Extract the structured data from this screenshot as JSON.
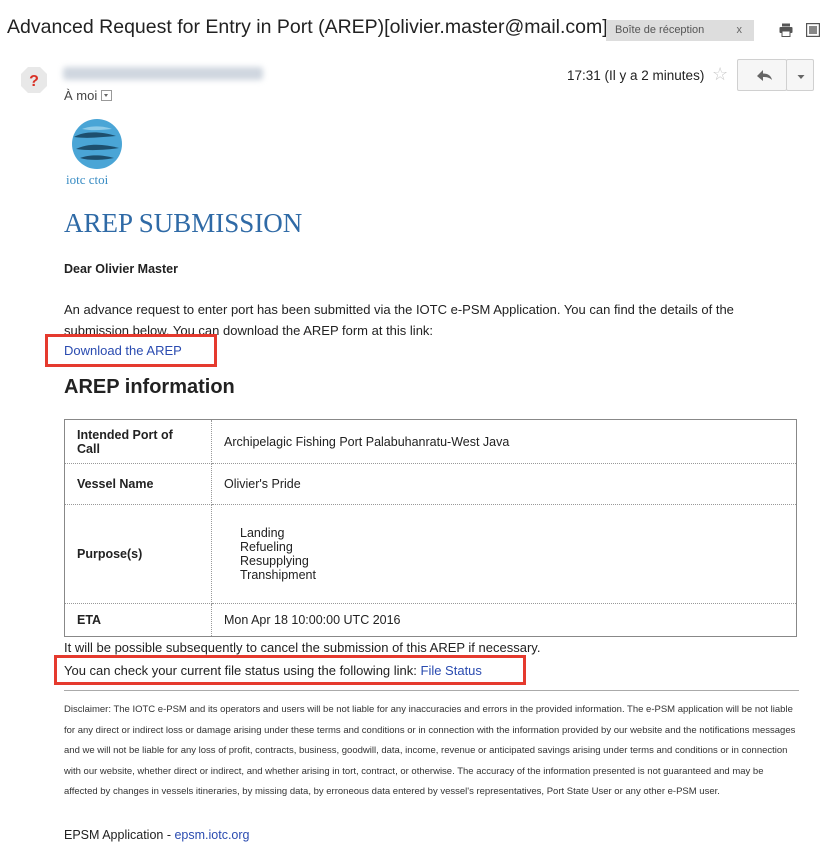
{
  "email": {
    "subject": "Advanced Request for Entry in Port (AREP)[olivier.master@mail.com]",
    "label_chip": "Boîte de réception",
    "label_chip_close": "x",
    "to_me": "À moi",
    "time": "17:31 (Il y a 2 minutes)"
  },
  "body": {
    "logo_text": "iotc ctoi",
    "title": "AREP SUBMISSION",
    "greeting": "Dear Olivier Master",
    "intro": "An advance request to enter port has been submitted via the IOTC e-PSM Application. You can find the details of the submission below. You can download the AREP form at this link:",
    "download_link": "Download the AREP",
    "section_title": "AREP information",
    "table": {
      "port_label": "Intended Port of Call",
      "port_value": "Archipelagic Fishing Port Palabuhanratu-West Java",
      "vessel_label": "Vessel Name",
      "vessel_value": "Olivier's Pride",
      "purpose_label": "Purpose(s)",
      "purposes": [
        "Landing",
        "Refueling",
        "Resupplying",
        "Transhipment"
      ],
      "eta_label": "ETA",
      "eta_value": "Mon Apr 18 10:00:00 UTC 2016"
    },
    "cancel_note": "It will be possible subsequently to cancel the submission of this AREP if necessary.",
    "status_text": "You can check your current file status using the following link: ",
    "status_link": "File Status",
    "disclaimer": "Disclaimer: The IOTC e-PSM and its operators and users will be not liable for any inaccuracies and errors in the provided information. The e-PSM application will be not liable for any direct or indirect loss or damage arising under these terms and conditions or in connection with the information provided by our website and the notifications messages and we will not be liable for any loss of profit, contracts, business, goodwill, data, income, revenue or anticipated savings arising under terms and conditions or in connection with our website, whether direct or indirect, and whether arising in tort, contract, or otherwise. The accuracy of the information presented is not guaranteed and may be affected by changes in vessels itineraries, by missing data, by erroneous data entered by vessel's representatives, Port State User or any other e-PSM user.",
    "footer_text": "EPSM Application - ",
    "footer_link": "epsm.iotc.org"
  },
  "colors": {
    "title_blue": "#2f6aa6",
    "link_blue": "#2a4bb0",
    "highlight_red": "#e53a2e",
    "avatar_red": "#d93025"
  },
  "icons": [
    "print-icon",
    "new-window-icon",
    "sender-avatar-icon",
    "star-icon",
    "reply-icon",
    "more-options-icon",
    "iotc-logo-icon"
  ]
}
